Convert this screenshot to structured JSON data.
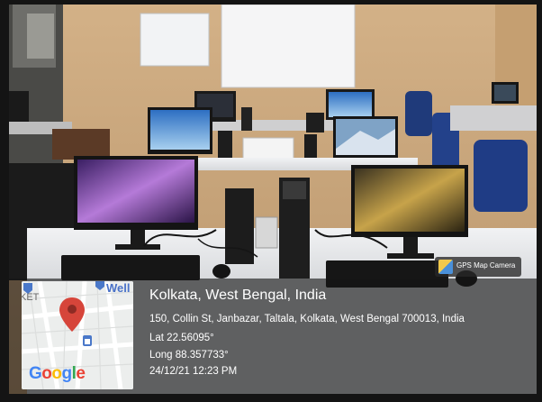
{
  "geotag": {
    "app_badge": "GPS Map Camera",
    "place": "Kolkata, West Bengal, India",
    "address": "150, Collin St, Janbazar, Taltala, Kolkata, West Bengal 700013, India",
    "latitude": "Lat 22.56095°",
    "longitude": "Long 88.357733°",
    "timestamp": "24/12/21 12:23 PM"
  },
  "map": {
    "label_top": "Well",
    "label_left": "KET",
    "brand": "Google",
    "pin_color": "#d6453a"
  },
  "colors": {
    "wall": "#c9a57a",
    "overlay": "#141414",
    "desk": "#e6e7ea"
  }
}
